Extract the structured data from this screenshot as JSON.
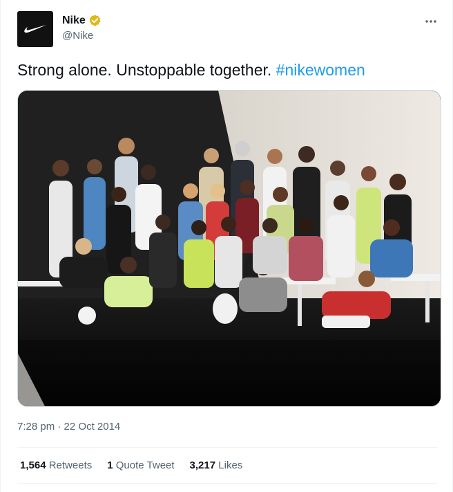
{
  "author": {
    "display_name": "Nike",
    "handle": "@Nike",
    "avatar_icon": "nike-swoosh-logo",
    "verified_badge_color": "#e2b719"
  },
  "tweet": {
    "text": "Strong alone. Unstoppable together. ",
    "hashtag": "#nikewomen"
  },
  "media": {
    "type": "photo"
  },
  "meta": {
    "time": "7:28 pm",
    "separator": " · ",
    "date": "22 Oct 2014"
  },
  "stats": {
    "retweets_count": "1,564",
    "retweets_label": "Retweets",
    "quote_count": "1",
    "quote_label": "Quote Tweet",
    "likes_count": "3,217",
    "likes_label": "Likes"
  },
  "colors": {
    "link": "#1d9bf0",
    "secondary_text": "#536471",
    "primary_text": "#0f1419"
  },
  "icons": {
    "more": "more-horizontal-icon"
  }
}
